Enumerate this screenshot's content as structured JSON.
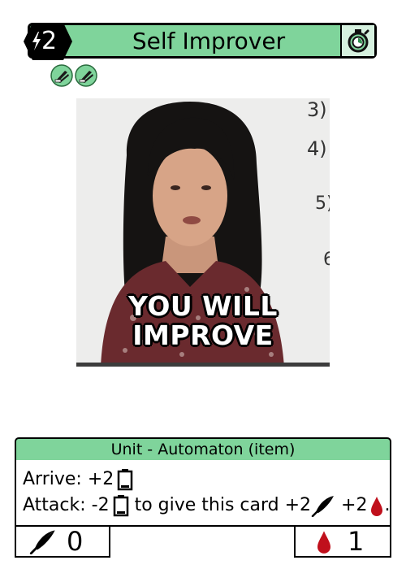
{
  "card": {
    "title": "Self Improver",
    "cost": "2",
    "type_line": "Unit - Automaton (item)",
    "art_caption": [
      "YOU WILL",
      "IMPROVE"
    ],
    "abilities": {
      "arrive": {
        "prefix": "Arrive: +2"
      },
      "attack": {
        "prefix": "Attack: -2",
        "middle": " to give this card +2",
        "sep": " +2",
        "end": "."
      }
    },
    "stats": {
      "quill": "0",
      "blood": "1"
    },
    "icons": [
      "lightning-icon",
      "stopwatch-icon",
      "token-icon",
      "battery-icon",
      "quill-icon",
      "blood-drop-icon"
    ],
    "colors": {
      "accent": "#7fd49b",
      "timer_bg": "#d6f1df",
      "blood": "#c0101c",
      "token": "#3aa35c"
    }
  }
}
